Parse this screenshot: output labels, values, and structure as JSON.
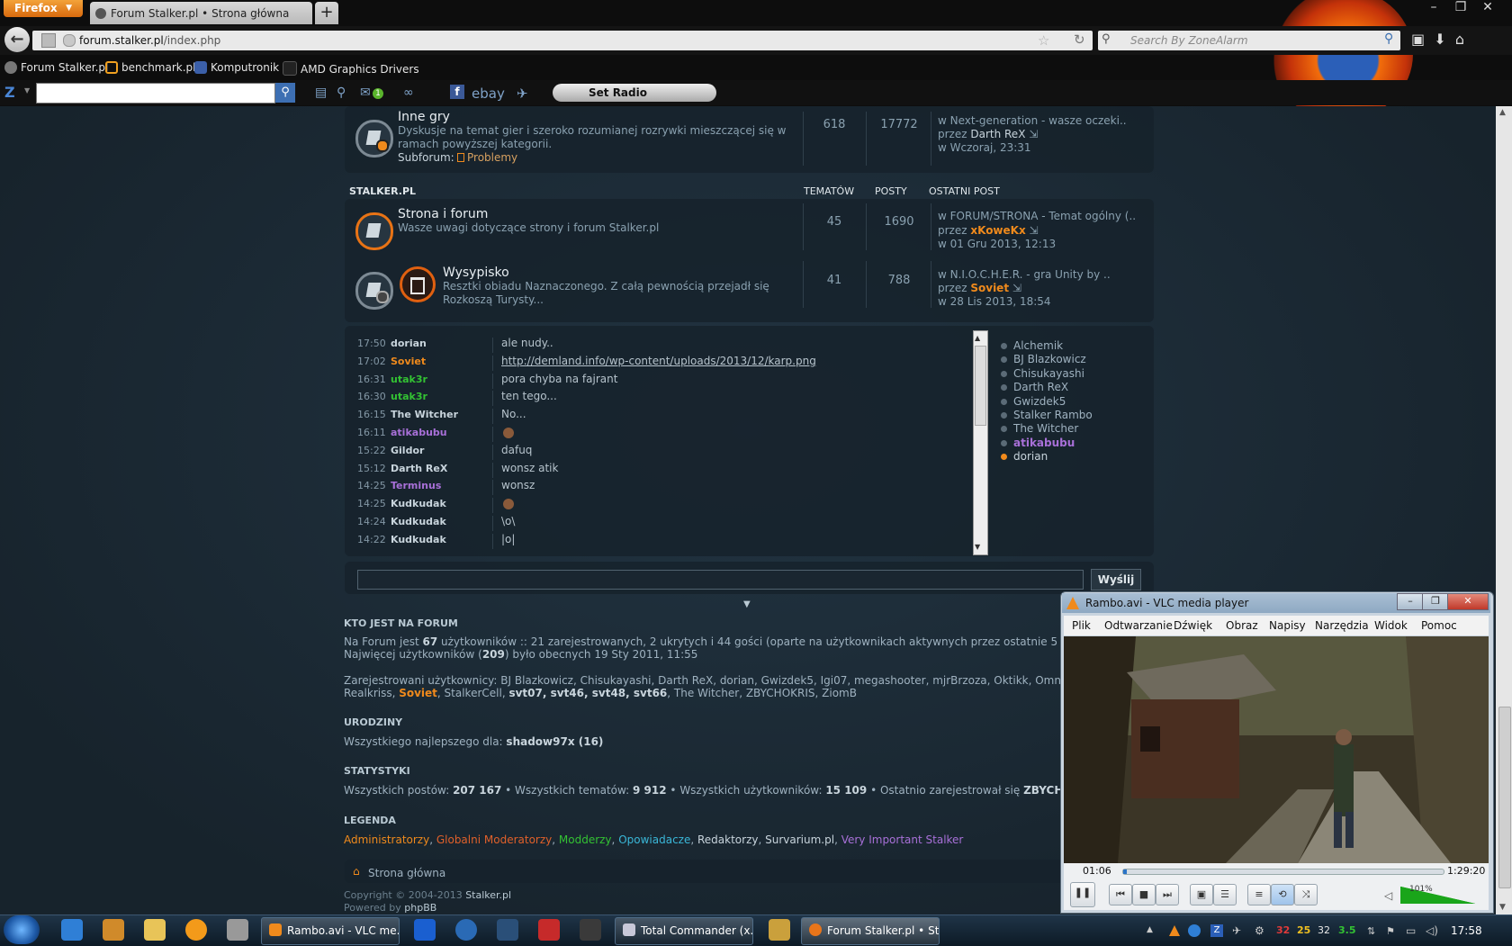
{
  "browser": {
    "menu_button": "Firefox",
    "tab_title": "Forum Stalker.pl • Strona główna",
    "new_tab": "+",
    "url_domain": "forum.stalker.pl",
    "url_path": "/index.php",
    "search_placeholder": "Search By ZoneAlarm",
    "bookmarks": [
      "Forum Stalker.pl",
      "benchmark.pl",
      "Komputronik",
      "AMD Graphics Drivers"
    ],
    "toolbar": {
      "za_logo": "Z",
      "set_radio": "Set Radio",
      "ebay": "ebay",
      "badge": "1"
    }
  },
  "forum": {
    "inne_gry": {
      "title": "Inne gry",
      "desc1": "Dyskusje na temat gier i szeroko rozumianej rozrywki mieszczącej się w",
      "desc2": "ramach powyższej kategorii.",
      "subforum_label": "Subforum:",
      "subforum": "Problemy",
      "topics": "618",
      "posts": "17772",
      "last_in": "w Next-generation - wasze oczeki..",
      "last_by_prefix": "przez",
      "last_by": "Darth ReX",
      "last_date": "w Wczoraj, 23:31"
    },
    "section": {
      "name": "STALKER.PL",
      "col_topics": "TEMATÓW",
      "col_posts": "POSTY",
      "col_last": "OSTATNI POST"
    },
    "strona": {
      "title": "Strona i forum",
      "desc": "Wasze uwagi dotyczące strony i forum Stalker.pl",
      "topics": "45",
      "posts": "1690",
      "last_in": "w FORUM/STRONA - Temat ogólny (..",
      "last_by": "xKoweKx",
      "last_date": "w 01 Gru 2013, 12:13"
    },
    "wysypisko": {
      "title": "Wysypisko",
      "desc1": "Resztki obiadu Naznaczonego. Z całą pewnością przejadł się",
      "desc2": "Rozkoszą Turysty...",
      "topics": "41",
      "posts": "788",
      "last_in": "w N.I.O.C.H.E.R. - gra Unity by ..",
      "last_by": "Soviet",
      "last_date": "w 28 Lis 2013, 18:54"
    }
  },
  "chat": {
    "messages": [
      {
        "time": "17:50",
        "user": "dorian",
        "msg": "ale nudy..",
        "color": "#c8d4dc"
      },
      {
        "time": "17:02",
        "user": "Soviet",
        "msg": "http://demland.info/wp-content/uploads/2013/12/karp.png",
        "color": "#f08a1c"
      },
      {
        "time": "16:31",
        "user": "utak3r",
        "msg": "pora chyba na fajrant",
        "color": "#33c233"
      },
      {
        "time": "16:30",
        "user": "utak3r",
        "msg": "ten tego...",
        "color": "#33c233"
      },
      {
        "time": "16:15",
        "user": "The Witcher",
        "msg": "No...",
        "color": "#c8d4dc"
      },
      {
        "time": "16:11",
        "user": "atikabubu",
        "msg": "",
        "color": "#a870d8"
      },
      {
        "time": "15:22",
        "user": "Gildor",
        "msg": "dafuq",
        "color": "#c8d4dc"
      },
      {
        "time": "15:12",
        "user": "Darth ReX",
        "msg": "wonsz atik",
        "color": "#c8d4dc"
      },
      {
        "time": "14:25",
        "user": "Terminus",
        "msg": "wonsz",
        "color": "#a870d8"
      },
      {
        "time": "14:25",
        "user": "Kudkudak",
        "msg": "",
        "color": "#c8d4dc"
      },
      {
        "time": "14:24",
        "user": "Kudkudak",
        "msg": "\\o\\",
        "color": "#c8d4dc"
      },
      {
        "time": "14:22",
        "user": "Kudkudak",
        "msg": "|o|",
        "color": "#c8d4dc"
      }
    ],
    "online": [
      "Alchemik",
      "BJ Blazkowicz",
      "Chisukayashi",
      "Darth ReX",
      "Gwizdek5",
      "Stalker Rambo",
      "The Witcher",
      "atikabubu",
      "dorian"
    ],
    "send_button": "Wyślij"
  },
  "who": {
    "heading": "KTO JEST NA FORUM",
    "line1_a": "Na Forum jest ",
    "line1_n": "67",
    "line1_b": " użytkowników :: 21 zarejestrowanych, 2 ukrytych i 44 gości (oparte na użytkownikach aktywnych przez ostatnie 5 minut)",
    "line2_a": "Najwięcej użytkowników (",
    "line2_n": "209",
    "line2_b": ") było obecnych 19 Sty 2011, 11:55",
    "reg_label": "Zarejestrowani użytkownicy: ",
    "reg_1": "BJ Blazkowicz, Chisukayashi, Darth ReX, dorian, Gwizdek5, Igi07, megashooter, mjrBrzoza, Oktikk, Omnibus,",
    "reg_2a": "Realkriss, ",
    "reg_2b": "Soviet",
    "reg_2c": ", StalkerCell, ",
    "reg_2d": "svt07, svt46, svt48, svt66",
    "reg_2e": ", The Witcher, ZBYCHOKRIS, ZiomB"
  },
  "birthdays": {
    "heading": "URODZINY",
    "text": "Wszystkiego najlepszego dla: ",
    "user": "shadow97x (16)"
  },
  "stats": {
    "heading": "STATYSTYKI",
    "a": "Wszystkich postów: ",
    "posts": "207 167",
    "b": " • Wszystkich tematów: ",
    "topics": "9 912",
    "c": " • Wszystkich użytkowników: ",
    "users": "15 109",
    "d": " • Ostatnio zarejestrował się ",
    "newest": "ZBYCHOKRIS"
  },
  "legend": {
    "heading": "LEGENDA",
    "items": [
      {
        "label": "Administratorzy",
        "color": "#f08a1c"
      },
      {
        "label": "Globalni Moderatorzy",
        "color": "#e0602a"
      },
      {
        "label": "Modderzy",
        "color": "#33c233"
      },
      {
        "label": "Opowiadacze",
        "color": "#3ab7d8"
      },
      {
        "label": "Redaktorzy",
        "color": "#c8d4dc"
      },
      {
        "label": "Survarium.pl",
        "color": "#c8d4dc"
      },
      {
        "label": "Very Important Stalker",
        "color": "#a870d8"
      }
    ]
  },
  "footer": {
    "breadcrumb": "Strona główna",
    "copyright_a": "Copyright © 2004-2013 ",
    "copyright_b": "Stalker.pl",
    "powered_a": "Powered by ",
    "powered_b": "phpBB"
  },
  "vlc": {
    "title": "Rambo.avi - VLC media player",
    "menu": [
      "Plik",
      "Odtwarzanie",
      "Dźwięk",
      "Obraz",
      "Napisy",
      "Narzędzia",
      "Widok",
      "Pomoc"
    ],
    "time_current": "01:06",
    "time_total": "1:29:20",
    "volume": "101%",
    "progress": 0.012
  },
  "taskbar": {
    "tasks": [
      "Rambo.avi - VLC me...",
      "Total Commander (x...",
      "Forum Stalker.pl • Str..."
    ],
    "tray_numbers": [
      "32",
      "25",
      "32",
      "3.5"
    ],
    "clock": "17:58"
  }
}
